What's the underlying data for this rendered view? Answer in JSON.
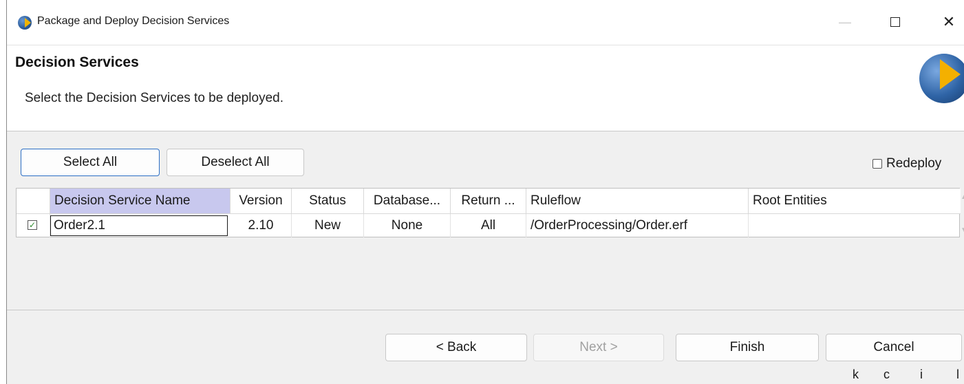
{
  "window": {
    "title": "Package and Deploy Decision Services",
    "minimize_glyph": "—",
    "close_glyph": "✕"
  },
  "header": {
    "title": "Decision Services",
    "description": "Select the Decision Services to be deployed."
  },
  "toolbar": {
    "select_all": "Select All",
    "deselect_all": "Deselect All",
    "redeploy_label": "Redeploy",
    "redeploy_checked": false
  },
  "table": {
    "columns": [
      "",
      "Decision Service Name",
      "Version",
      "Status",
      "Database...",
      "Return ...",
      "Ruleflow",
      "Root Entities"
    ],
    "rows": [
      {
        "checked": true,
        "check_glyph": "✓",
        "name": "Order2.1",
        "version": "2.10",
        "status": "New",
        "database": "None",
        "return": "All",
        "ruleflow": "/OrderProcessing/Order.erf",
        "root_entities": ""
      }
    ]
  },
  "footer": {
    "back": "< Back",
    "next": "Next >",
    "finish": "Finish",
    "cancel": "Cancel"
  },
  "shortcut_hints": [
    "k",
    "c",
    "i",
    "l"
  ],
  "icons": {
    "app": "app-logo-icon",
    "header_logo": "wizard-banner-logo-icon"
  },
  "colors": {
    "selected_column_header": "#c8c8ee",
    "focus_border": "#2b6ec4",
    "check_green": "#2e8b2e"
  }
}
